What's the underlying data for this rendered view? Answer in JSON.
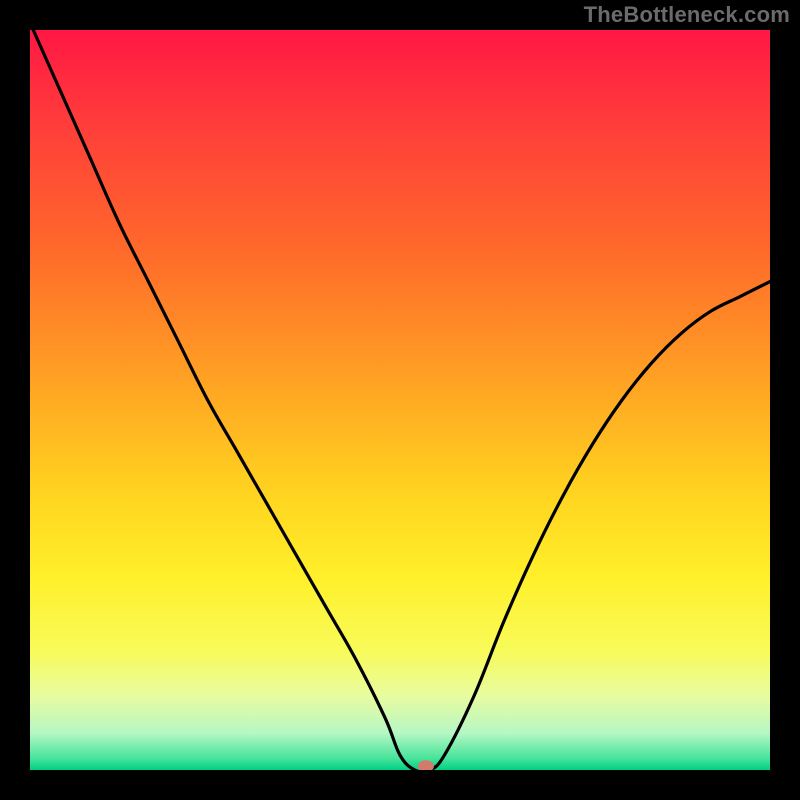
{
  "watermark": "TheBottleneck.com",
  "chart_data": {
    "type": "line",
    "title": "",
    "xlabel": "",
    "ylabel": "",
    "xlim": [
      0,
      100
    ],
    "ylim": [
      0,
      100
    ],
    "background_gradient": {
      "stops": [
        {
          "offset": 0.0,
          "color": "#ff1744"
        },
        {
          "offset": 0.12,
          "color": "#ff3b3b"
        },
        {
          "offset": 0.3,
          "color": "#ff6a2a"
        },
        {
          "offset": 0.48,
          "color": "#ffa423"
        },
        {
          "offset": 0.62,
          "color": "#ffd21f"
        },
        {
          "offset": 0.74,
          "color": "#fff02a"
        },
        {
          "offset": 0.84,
          "color": "#f8fb5a"
        },
        {
          "offset": 0.9,
          "color": "#e8fca0"
        },
        {
          "offset": 0.95,
          "color": "#b6f7c4"
        },
        {
          "offset": 0.985,
          "color": "#44e39a"
        },
        {
          "offset": 1.0,
          "color": "#00d084"
        }
      ]
    },
    "series": [
      {
        "name": "bottleneck-curve",
        "color": "#000000",
        "stroke_width": 3.2,
        "x": [
          0,
          4,
          8,
          12,
          16,
          20,
          24,
          28,
          32,
          36,
          40,
          44,
          48,
          50,
          52,
          54,
          56,
          60,
          64,
          68,
          72,
          76,
          80,
          84,
          88,
          92,
          96,
          100
        ],
        "y": [
          101,
          92,
          83,
          74,
          66,
          58,
          50,
          43,
          36,
          29,
          22,
          15,
          7,
          2,
          0,
          0,
          2,
          10,
          20,
          29,
          37,
          44,
          50,
          55,
          59,
          62,
          64,
          66
        ]
      }
    ],
    "marker": {
      "name": "optimal-point",
      "x": 53.5,
      "y": 0.5,
      "color": "#d47a6a",
      "rx": 8,
      "ry": 6
    }
  }
}
